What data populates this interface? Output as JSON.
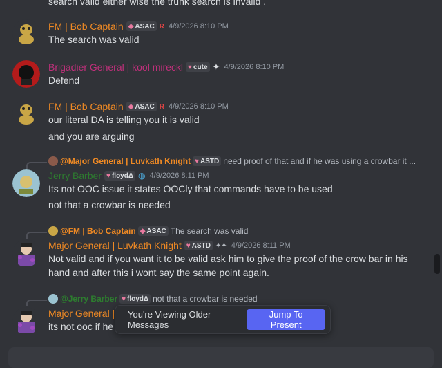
{
  "top_partial_text": "search valid either wise the trunk search is invalid .",
  "messages": [
    {
      "username": "FM | Bob Captain",
      "name_color": "#f08a24",
      "tags": [
        "ASAC"
      ],
      "extra_badge": "R",
      "timestamp": "4/9/2026 8:10 PM",
      "lines": [
        "The search was valid"
      ]
    },
    {
      "username": "Brigadier General | kool mireckl",
      "name_color": "#c0307b",
      "tags": [
        "cute"
      ],
      "extra_badge": "✦",
      "timestamp": "4/9/2026 8:10 PM",
      "lines": [
        "Defend"
      ]
    },
    {
      "username": "FM | Bob Captain",
      "name_color": "#f08a24",
      "tags": [
        "ASAC"
      ],
      "extra_badge": "R",
      "timestamp": "4/9/2026 8:10 PM",
      "lines": [
        "our literal DA is telling you it is valid",
        "and you are arguing"
      ]
    },
    {
      "reply": {
        "mention": "@Major General | Luvkath Knight",
        "tag": "ASTD",
        "text": "need proof of that and if he was using a crowbar it ..."
      },
      "username": "Jerry Barber",
      "name_color": "#2d7d2f",
      "tags": [
        "floydΔ"
      ],
      "extra_badge": "◍",
      "timestamp": "4/9/2026 8:11 PM",
      "lines": [
        "Its not OOC issue it states OOCly that commands have to be used",
        "not that a crowbar is needed"
      ]
    },
    {
      "reply": {
        "mention": "@FM | Bob Captain",
        "tag": "ASAC",
        "text": "The search was valid"
      },
      "username": "Major General | Luvkath Knight",
      "name_color": "#f08a24",
      "tags": [
        "ASTD"
      ],
      "extra_badge": "✦✦",
      "timestamp": "4/9/2026 8:11 PM",
      "lines": [
        "Not valid and if you want it to be valid ask him to give the proof of the crow bar in his",
        "hand and after this i wont say the same point again."
      ]
    },
    {
      "reply": {
        "mention": "@Jerry Barber",
        "tag": "floydΔ",
        "text": "not that a crowbar is needed"
      },
      "username": "Major General |",
      "name_color": "#f08a24",
      "lines": [
        "its not ooc if he"
      ]
    }
  ],
  "older_bar": {
    "text": "You're Viewing Older Messages",
    "button": "Jump To Present"
  },
  "colors": {
    "background": "#313338",
    "accent": "#5865f2",
    "tag_heart": "#e8799f"
  }
}
